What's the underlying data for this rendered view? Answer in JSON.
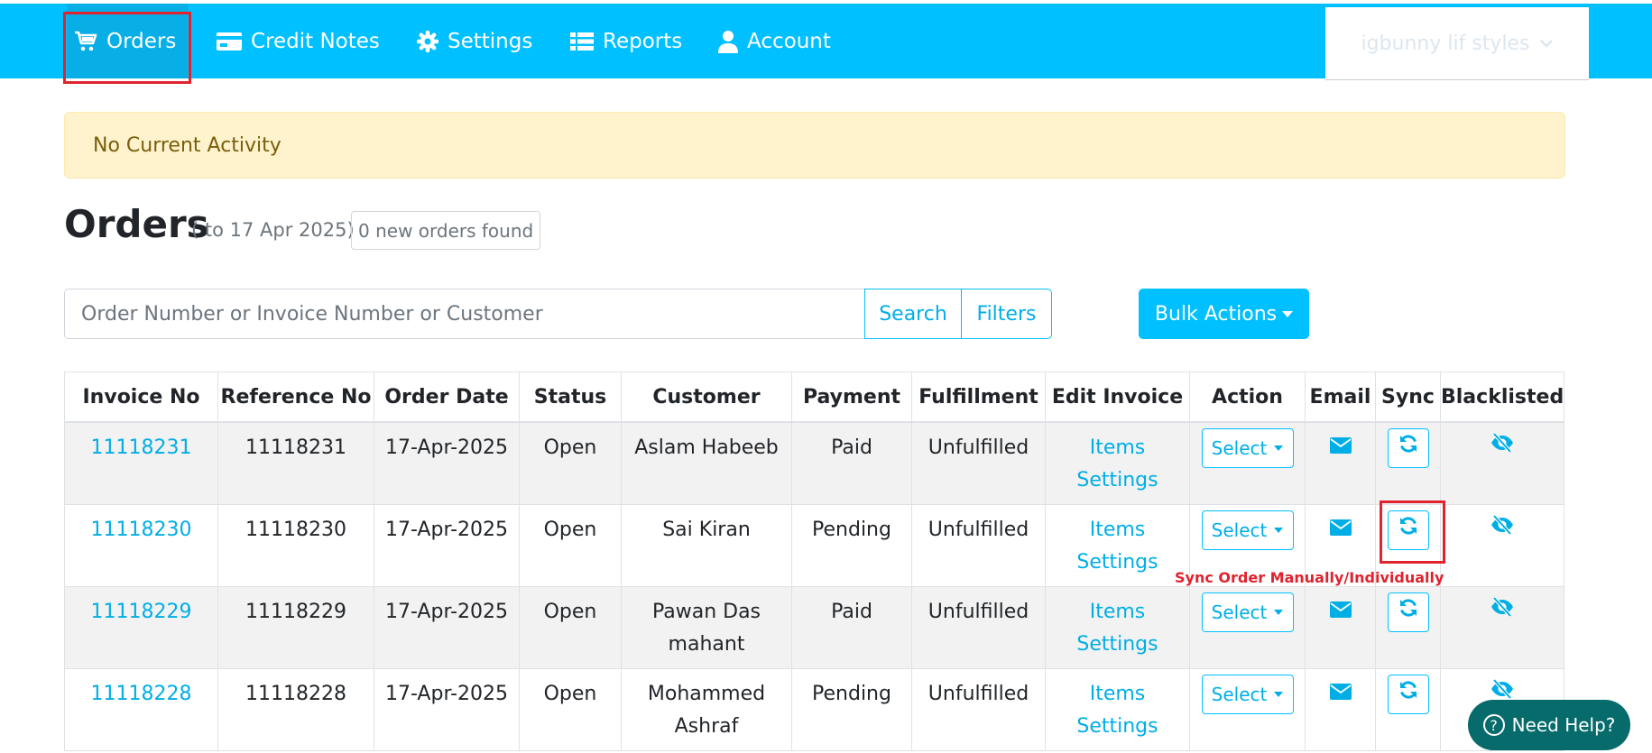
{
  "nav": {
    "items": [
      {
        "label": "Orders",
        "icon": "cart-icon"
      },
      {
        "label": "Credit Notes",
        "icon": "credit-card-icon"
      },
      {
        "label": "Settings",
        "icon": "gear-icon"
      },
      {
        "label": "Reports",
        "icon": "list-icon"
      },
      {
        "label": "Account",
        "icon": "user-icon"
      }
    ],
    "shop_name": "igbunny lif styles"
  },
  "alert": {
    "text": "No Current Activity"
  },
  "heading": {
    "title": "Orders",
    "date_range": "( to 17 Apr 2025)",
    "new_orders": "0 new orders found"
  },
  "search": {
    "placeholder": "Order Number or Invoice Number or Customer",
    "search_label": "Search",
    "filters_label": "Filters",
    "bulk_actions_label": "Bulk Actions"
  },
  "table": {
    "columns": [
      "Invoice No",
      "Reference No",
      "Order Date",
      "Status",
      "Customer",
      "Payment",
      "Fulfillment",
      "Edit Invoice",
      "Action",
      "Email",
      "Sync",
      "Blacklisted"
    ],
    "rows": [
      {
        "invoice": "11118231",
        "reference": "11118231",
        "date": "17-Apr-2025",
        "status": "Open",
        "customer": "Aslam Habeeb",
        "payment": "Paid",
        "fulfillment": "Unfulfilled",
        "edit_items": "Items",
        "edit_settings": "Settings",
        "action": "Select"
      },
      {
        "invoice": "11118230",
        "reference": "11118230",
        "date": "17-Apr-2025",
        "status": "Open",
        "customer": "Sai Kiran",
        "payment": "Pending",
        "fulfillment": "Unfulfilled",
        "edit_items": "Items",
        "edit_settings": "Settings",
        "action": "Select"
      },
      {
        "invoice": "11118229",
        "reference": "11118229",
        "date": "17-Apr-2025",
        "status": "Open",
        "customer": "Pawan Das mahant",
        "payment": "Paid",
        "fulfillment": "Unfulfilled",
        "edit_items": "Items",
        "edit_settings": "Settings",
        "action": "Select"
      },
      {
        "invoice": "11118228",
        "reference": "11118228",
        "date": "17-Apr-2025",
        "status": "Open",
        "customer": "Mohammed Ashraf",
        "payment": "Pending",
        "fulfillment": "Unfulfilled",
        "edit_items": "Items",
        "edit_settings": "Settings",
        "action": "Select"
      }
    ]
  },
  "annotation": {
    "sync_note": "Sync Order Manually/Individually"
  },
  "help": {
    "label": "Need Help?"
  },
  "colors": {
    "primary": "#00c0ff",
    "highlight": "#e0232e",
    "alert_bg": "#fef3cd",
    "help_bg": "#076b6b"
  }
}
